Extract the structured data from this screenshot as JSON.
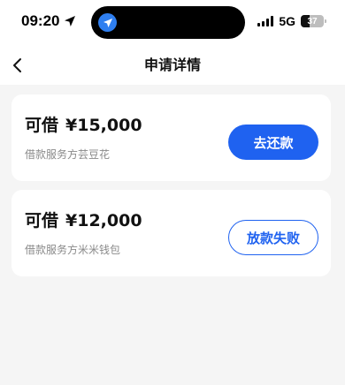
{
  "status_bar": {
    "time": "09:20",
    "network": "5G",
    "battery_level": "37",
    "location_icon": "location-arrow-icon",
    "island_app_icon": "send-icon"
  },
  "nav": {
    "title": "申请详情",
    "back_icon": "chevron-left-icon"
  },
  "loans": [
    {
      "prefix": "可借",
      "amount": "¥15,000",
      "provider": "借款服务方芸豆花",
      "action": "去还款"
    },
    {
      "prefix": "可借",
      "amount": "¥12,000",
      "provider": "借款服务方米米钱包",
      "action": "放款失败"
    }
  ],
  "colors": {
    "accent": "#1f62f0",
    "background": "#f5f5f5",
    "card": "#ffffff",
    "secondary_text": "#8a8a8a"
  }
}
